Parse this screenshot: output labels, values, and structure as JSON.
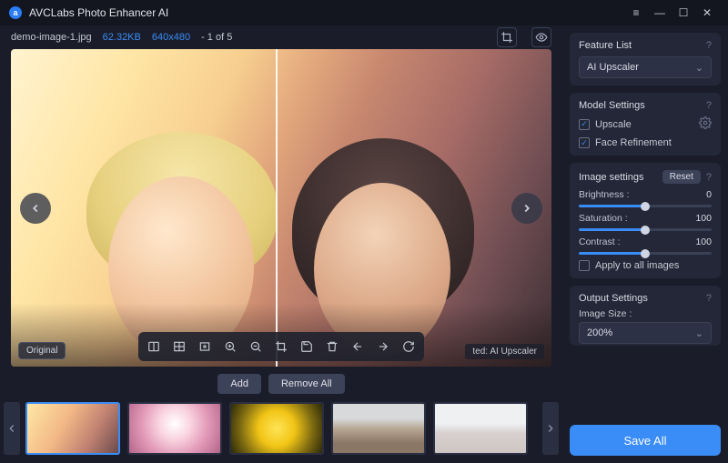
{
  "app": {
    "title": "AVCLabs Photo Enhancer AI"
  },
  "info": {
    "filename": "demo-image-1.jpg",
    "filesize": "62.32KB",
    "resolution": "640x480",
    "position": "- 1 of 5"
  },
  "preview": {
    "original_label": "Original",
    "result_label": "ted: AI Upscaler"
  },
  "thumb_actions": {
    "add": "Add",
    "remove_all": "Remove All"
  },
  "thumbs": [
    "demo-image-1",
    "anime",
    "sunflower",
    "city",
    "faces"
  ],
  "feature": {
    "heading": "Feature List",
    "selected": "AI Upscaler"
  },
  "model": {
    "heading": "Model Settings",
    "upscale_label": "Upscale",
    "upscale_checked": true,
    "face_label": "Face Refinement",
    "face_checked": true
  },
  "image": {
    "heading": "Image settings",
    "reset_label": "Reset",
    "brightness_label": "Brightness :",
    "brightness_value": 0,
    "saturation_label": "Saturation :",
    "saturation_value": 100,
    "contrast_label": "Contrast :",
    "contrast_value": 100,
    "apply_all_label": "Apply to all images",
    "apply_all_checked": false
  },
  "output": {
    "heading": "Output Settings",
    "size_label": "Image Size :",
    "size_value": "200%"
  },
  "save_label": "Save All"
}
